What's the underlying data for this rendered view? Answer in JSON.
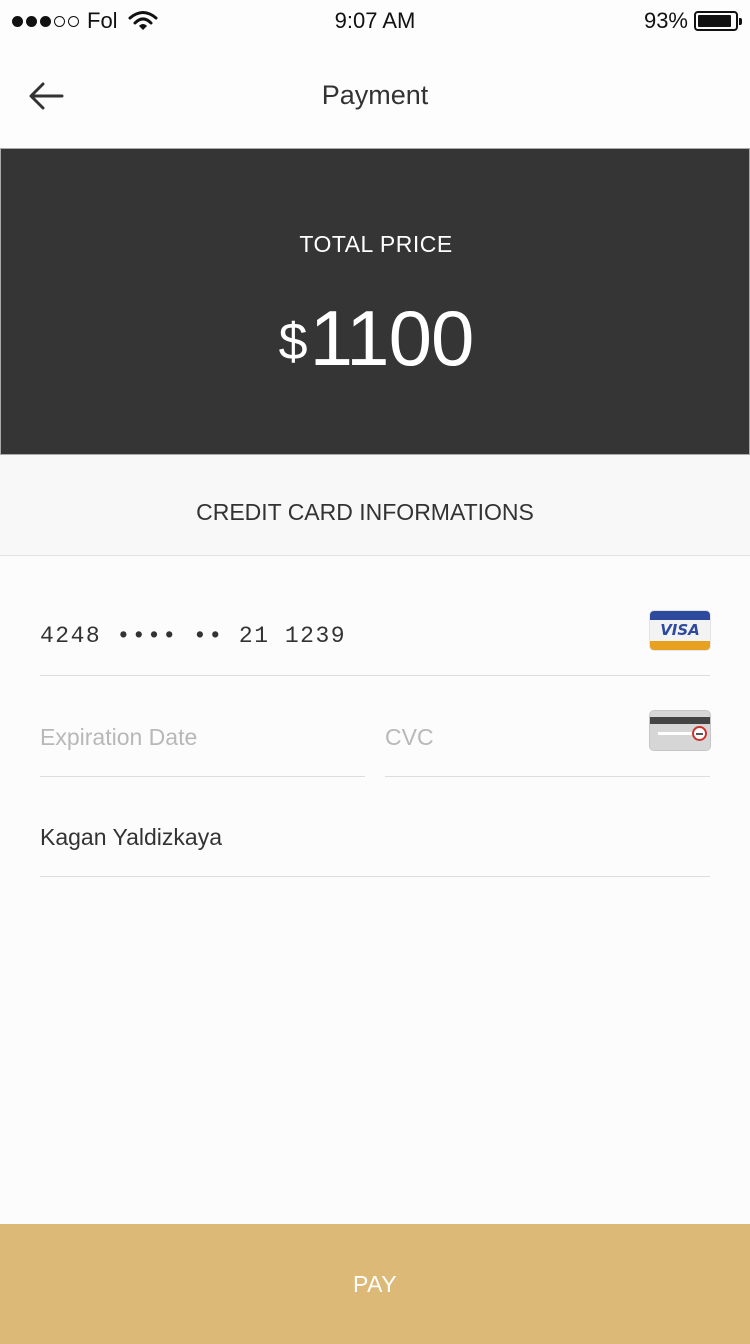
{
  "status_bar": {
    "signal_strength": "3 of 5",
    "carrier": "Fol",
    "time": "9:07 AM",
    "battery_percent": "93%",
    "battery_level": 0.93
  },
  "nav": {
    "title": "Payment",
    "back_icon": "arrow-left-icon"
  },
  "price_panel": {
    "label": "TOTAL PRICE",
    "currency": "$",
    "amount": "1100"
  },
  "section": {
    "title": "CREDIT CARD INFORMATIONS"
  },
  "form": {
    "card_number": "4248 •••• •• 21 1239",
    "card_brand": "VISA",
    "expiration_placeholder": "Expiration Date",
    "expiration_value": "",
    "cvc_placeholder": "CVC",
    "cvc_value": "",
    "cvc_icon": "card-cvc-icon",
    "cardholder_name": "Kagan Yaldizkaya"
  },
  "pay_button": {
    "label": "PAY"
  },
  "colors": {
    "price_panel_bg": "#353535",
    "pay_button_bg": "#dcb976",
    "visa_blue": "#2e4a9e",
    "visa_orange": "#e8a020"
  }
}
